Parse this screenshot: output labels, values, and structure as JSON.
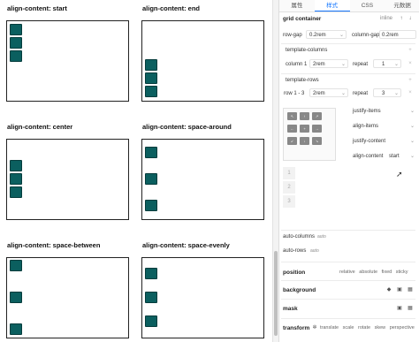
{
  "demos": [
    {
      "title": "align-content: start",
      "layout": "start"
    },
    {
      "title": "align-content: end",
      "layout": "end"
    },
    {
      "title": "align-content: center",
      "layout": "center"
    },
    {
      "title": "align-content: space-around",
      "layout": "space-around"
    },
    {
      "title": "align-content: space-between",
      "layout": "space-between"
    },
    {
      "title": "align-content: space-evenly",
      "layout": "space-evenly"
    }
  ],
  "tabs": [
    "属性",
    "样式",
    "CSS",
    "元数据"
  ],
  "active_tab": "样式",
  "grid_container": {
    "title": "grid container",
    "display_value": "inline",
    "row_gap_label": "row-gap",
    "row_gap_value": "0.2rem",
    "column_gap_label": "column-gap",
    "column_gap_value": "0.2rem"
  },
  "template_columns": {
    "title": "template-columns",
    "label": "column 1",
    "value": "2rem",
    "repeat_label": "repeat",
    "repeat_value": "1"
  },
  "template_rows": {
    "title": "template-rows",
    "label": "row 1 - 3",
    "value": "2rem",
    "repeat_label": "repeat",
    "repeat_value": "3"
  },
  "alignment": {
    "justify_items": "justify-items",
    "align_items": "align-items",
    "justify_content": "justify-content",
    "align_content": "align-content",
    "align_content_value": "start"
  },
  "row_numbers": [
    "1",
    "2",
    "3"
  ],
  "auto_columns": {
    "label": "auto-columns",
    "value": "auto"
  },
  "auto_rows": {
    "label": "auto-rows",
    "value": "auto"
  },
  "position": {
    "label": "position",
    "options": [
      "relative",
      "absolute",
      "fixed",
      "sticky"
    ]
  },
  "background": {
    "label": "background"
  },
  "mask": {
    "label": "mask"
  },
  "transform": {
    "label": "transform",
    "options": [
      "translate",
      "scale",
      "rotate",
      "skew",
      "perspective"
    ]
  },
  "colors": {
    "cell": "#0b5f5f",
    "accent": "#1677ff"
  }
}
